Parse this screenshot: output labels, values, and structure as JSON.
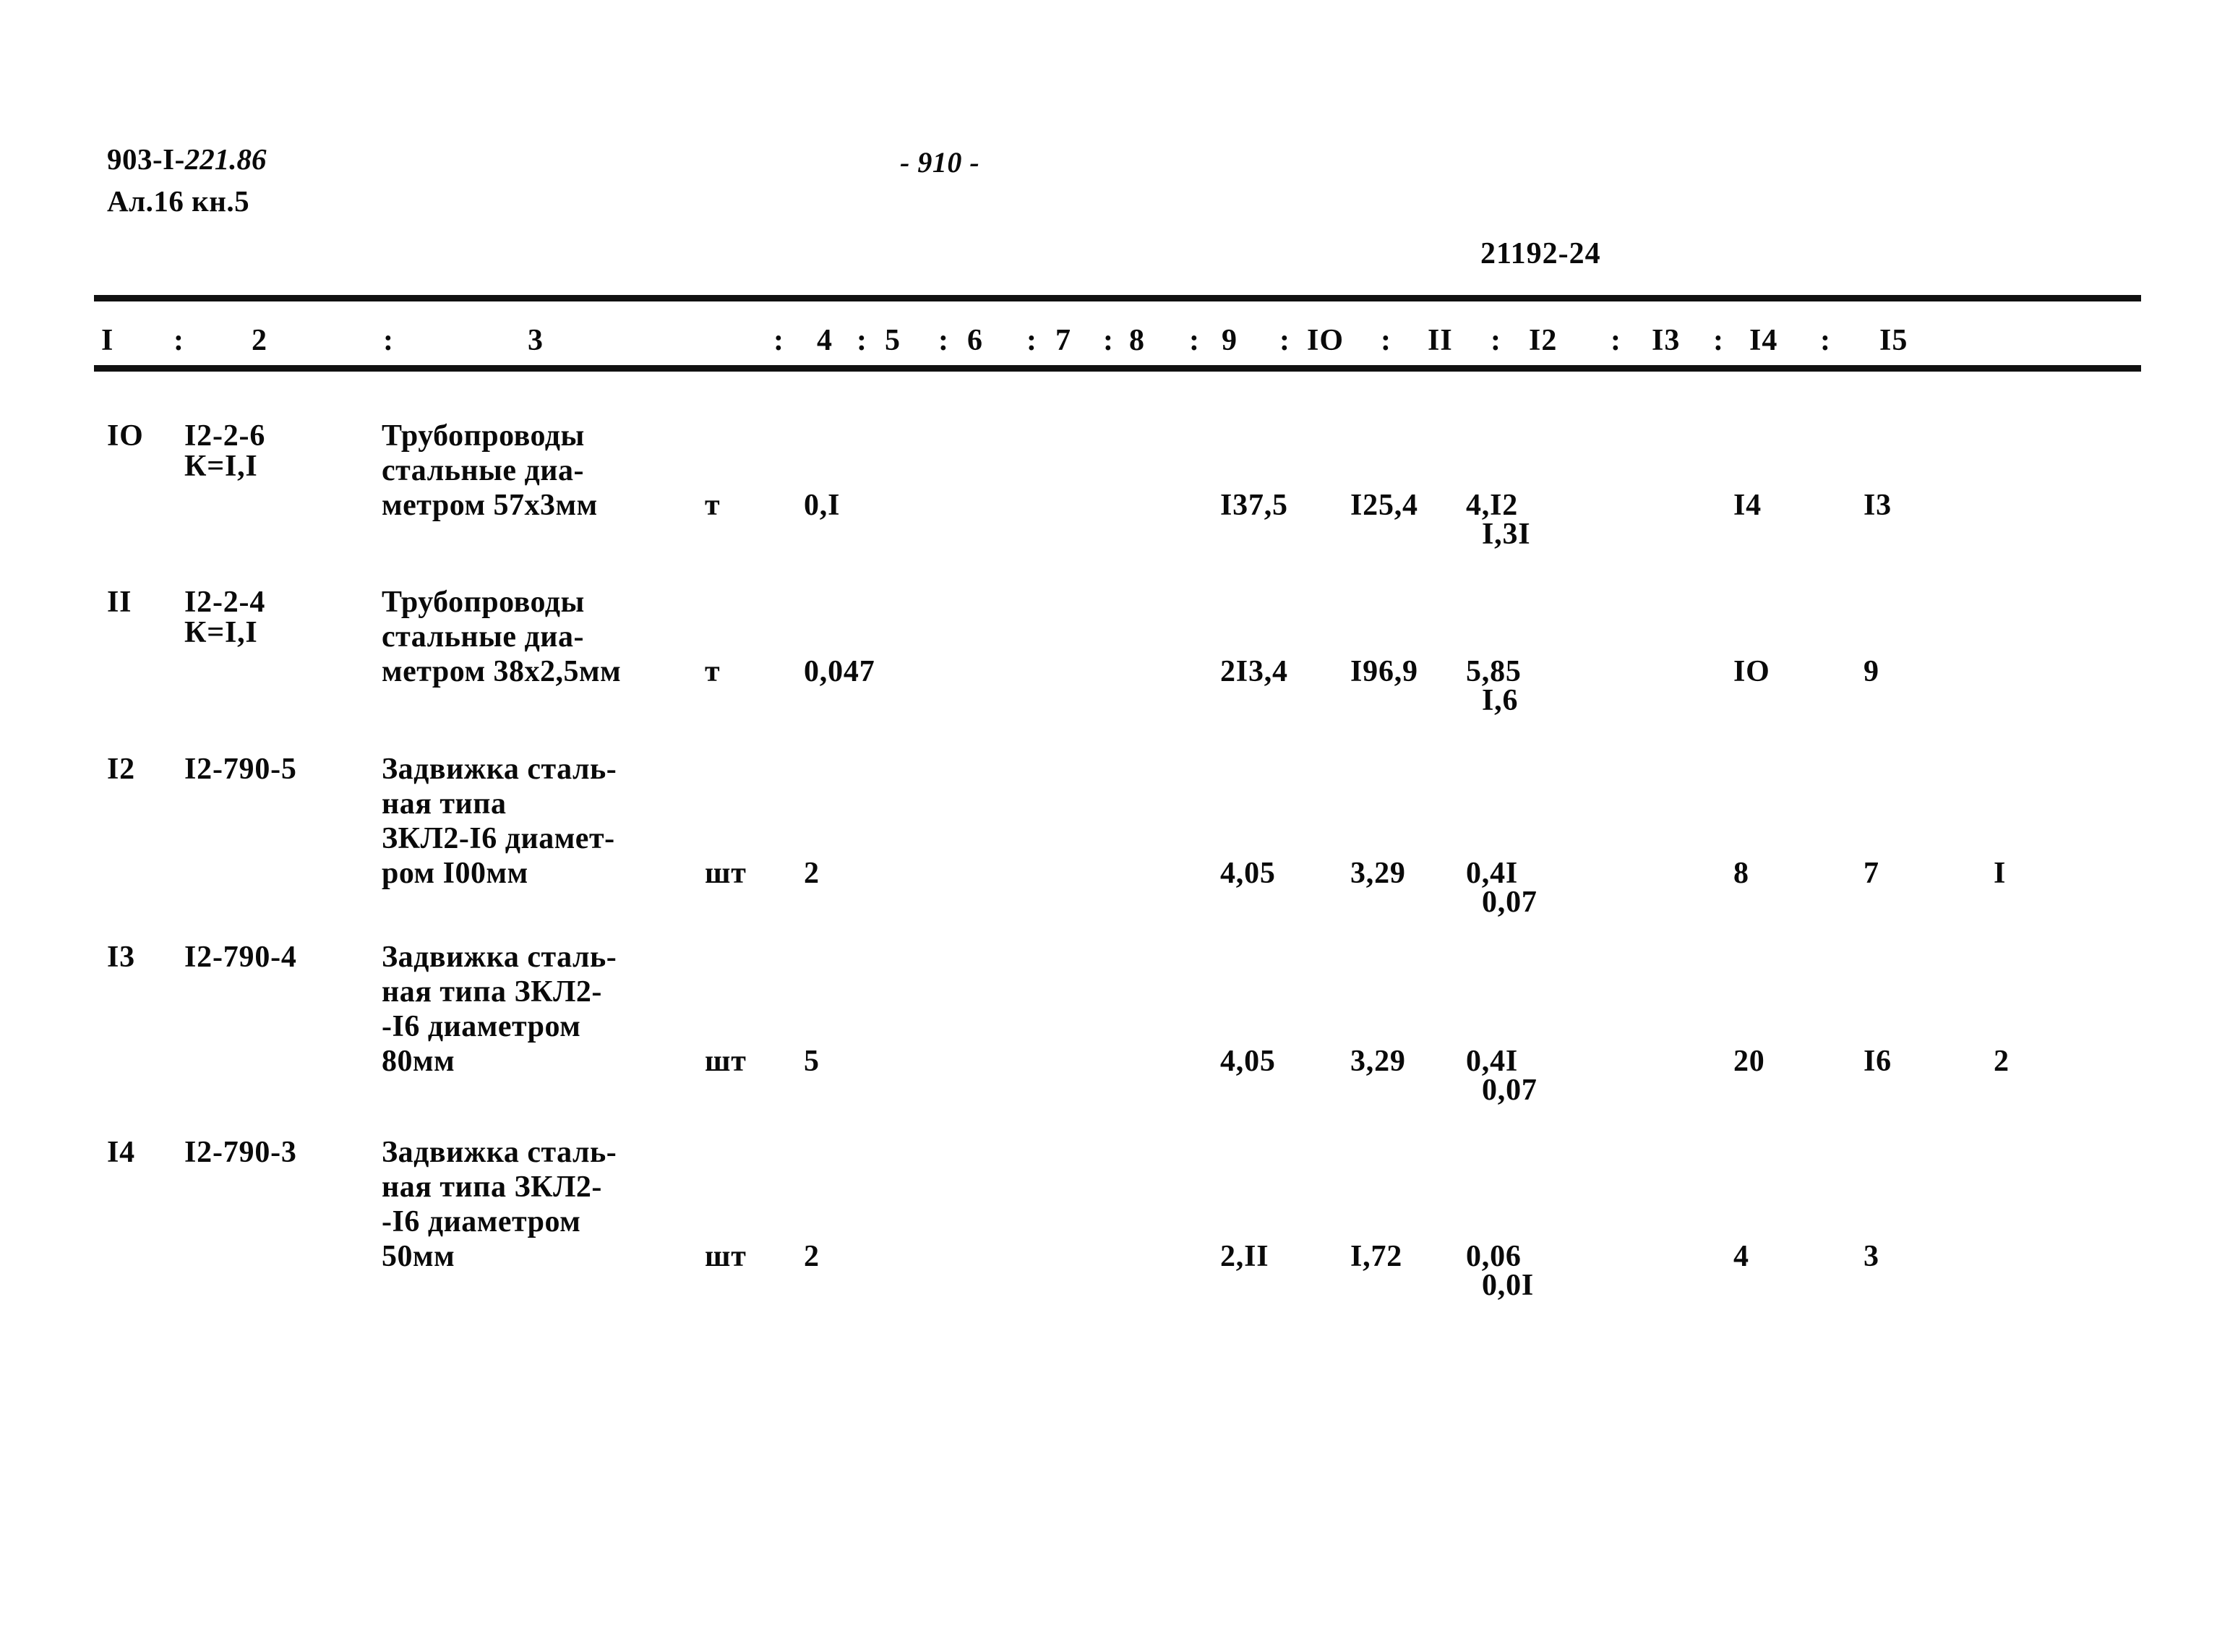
{
  "header": {
    "doc_code_prefix": "903-I-",
    "doc_code_hand": "221.86",
    "album": "Ал.16 кн.5",
    "page_number": "- 910 -",
    "sheet_code": "21192-24"
  },
  "table": {
    "column_headers": [
      "I",
      "2",
      "3",
      "4",
      "5",
      "6",
      "7",
      "8",
      "9",
      "IO",
      "II",
      "I2",
      "I3",
      "I4",
      "I5"
    ],
    "separator": ":",
    "rows": [
      {
        "no": "IO",
        "code": "I2-2-6",
        "coef": "К=I,I",
        "description": [
          "Трубопроводы",
          "стальные диа-",
          "метром 57х3мм"
        ],
        "unit": "т",
        "qty": "0,I",
        "c8": "I37,5",
        "c9": "I25,4",
        "c10": "4,I2",
        "c10_sub": "I,3I",
        "c12": "I4",
        "c13": "I3",
        "c14": ""
      },
      {
        "no": "II",
        "code": "I2-2-4",
        "coef": "К=I,I",
        "description": [
          "Трубопроводы",
          "стальные диа-",
          "метром 38х2,5мм"
        ],
        "unit": "т",
        "qty": "0,047",
        "c8": "2I3,4",
        "c9": "I96,9",
        "c10": "5,85",
        "c10_sub": "I,6",
        "c12": "IO",
        "c13": "9",
        "c14": ""
      },
      {
        "no": "I2",
        "code": "I2-790-5",
        "coef": "",
        "description": [
          "Задвижка сталь-",
          "ная типа",
          "ЗКЛ2-I6 диамет-",
          "ром I00мм"
        ],
        "unit": "шт",
        "qty": "2",
        "c8": "4,05",
        "c9": "3,29",
        "c10": "0,4I",
        "c10_sub": "0,07",
        "c12": "8",
        "c13": "7",
        "c14": "I"
      },
      {
        "no": "I3",
        "code": "I2-790-4",
        "coef": "",
        "description": [
          "Задвижка сталь-",
          "ная типа ЗКЛ2-",
          "-I6 диаметром",
          "80мм"
        ],
        "unit": "шт",
        "qty": "5",
        "c8": "4,05",
        "c9": "3,29",
        "c10": "0,4I",
        "c10_sub": "0,07",
        "c12": "20",
        "c13": "I6",
        "c14": "2"
      },
      {
        "no": "I4",
        "code": "I2-790-3",
        "coef": "",
        "description": [
          "Задвижка сталь-",
          "ная типа ЗКЛ2-",
          "-I6 диаметром",
          "50мм"
        ],
        "unit": "шт",
        "qty": "2",
        "c8": "2,II",
        "c9": "I,72",
        "c10": "0,06",
        "c10_sub": "0,0I",
        "c12": "4",
        "c13": "3",
        "c14": ""
      }
    ]
  }
}
